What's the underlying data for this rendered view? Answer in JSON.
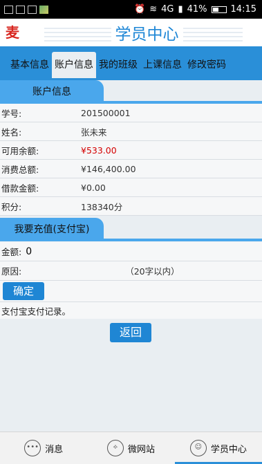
{
  "status_bar": {
    "network": "4G",
    "battery": "41%",
    "time": "14:15"
  },
  "header": {
    "logo_text": "麦田",
    "title": "学员中心"
  },
  "tabs": [
    {
      "label": "基本信息"
    },
    {
      "label": "账户信息"
    },
    {
      "label": "我的班级"
    },
    {
      "label": "上课信息"
    },
    {
      "label": "修改密码"
    }
  ],
  "account_section": {
    "title": "账户信息",
    "rows": [
      {
        "label": "学号:",
        "value": "201500001"
      },
      {
        "label": "姓名:",
        "value": "张未来"
      },
      {
        "label": "可用余额:",
        "value": "¥533.00"
      },
      {
        "label": "消费总额:",
        "value": "¥146,400.00"
      },
      {
        "label": "借款金额:",
        "value": "¥0.00"
      },
      {
        "label": "积分:",
        "value": "138340分"
      }
    ]
  },
  "recharge_section": {
    "title": "我要充值(支付宝)",
    "amount_label": "金额:",
    "amount_value": "0",
    "reason_label": "原因:",
    "reason_hint": "（20字以内）",
    "confirm_label": "确定",
    "record_text": "支付宝支付记录。"
  },
  "back_label": "返回",
  "bottom_nav": [
    {
      "label": "消息",
      "icon": "message-icon"
    },
    {
      "label": "微网站",
      "icon": "website-icon"
    },
    {
      "label": "学员中心",
      "icon": "user-icon"
    }
  ],
  "colors": {
    "accent": "#2a8fd8",
    "balance_red": "#d40000"
  }
}
